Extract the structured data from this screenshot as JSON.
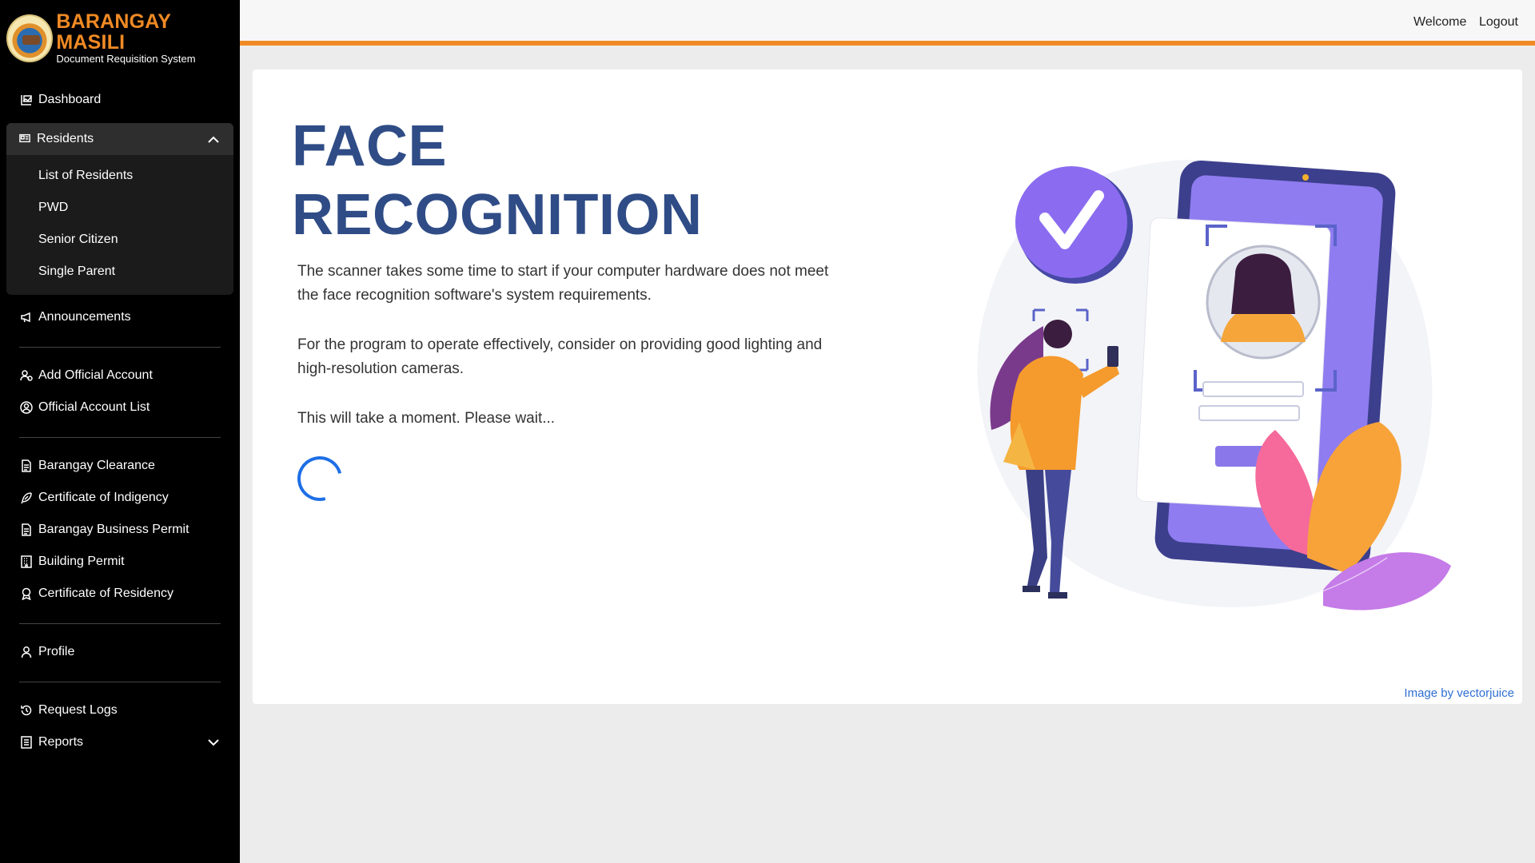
{
  "brand": {
    "title": "BARANGAY MASILI",
    "subtitle": "Document Requisition System"
  },
  "topbar": {
    "welcome": "Welcome",
    "logout": "Logout"
  },
  "sidebar": {
    "dashboard": "Dashboard",
    "residents": {
      "label": "Residents",
      "items": [
        "List of Residents",
        "PWD",
        "Senior Citizen",
        "Single Parent"
      ]
    },
    "announcements": "Announcements",
    "accounts": [
      "Add Official Account",
      "Official Account List"
    ],
    "documents": [
      "Barangay Clearance",
      "Certificate of Indigency",
      "Barangay Business Permit",
      "Building Permit",
      "Certificate of Residency"
    ],
    "profile": "Profile",
    "request_logs": "Request Logs",
    "reports": "Reports"
  },
  "main": {
    "title_line1": "FACE",
    "title_line2": "RECOGNITION",
    "para1": "The scanner takes some time to start if your computer hardware does not meet the face recognition software's system requirements.",
    "para2": "For the program to operate effectively, consider on providing good lighting and high-resolution cameras.",
    "para3": "This will take a moment. Please wait...",
    "credit": "Image by vectorjuice"
  },
  "colors": {
    "accent": "#f08a24",
    "title": "#2f4c86",
    "spinner": "#1e6fe6",
    "link": "#2f6fd1"
  }
}
